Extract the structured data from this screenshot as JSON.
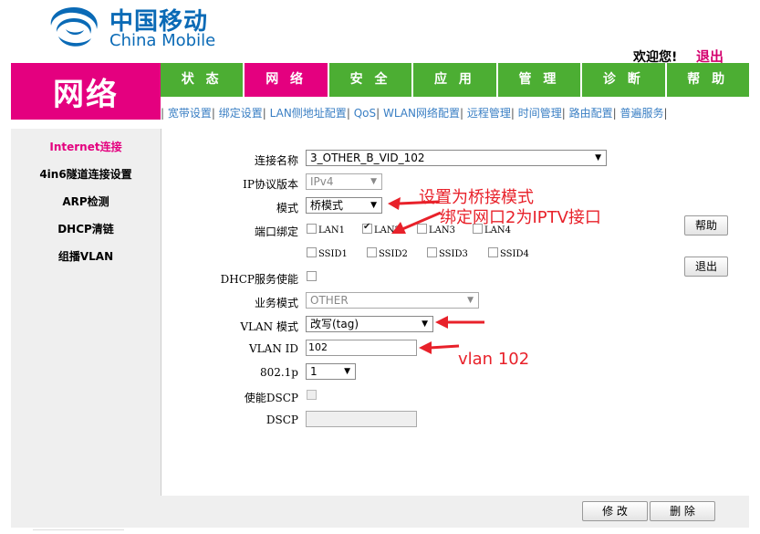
{
  "brand": {
    "cn": "中国移动",
    "en": "China Mobile",
    "color": "#0a6ab6"
  },
  "header": {
    "welcome": "欢迎您!",
    "logout": "退出"
  },
  "section_title": "网络",
  "tabs": [
    {
      "label": "状 态"
    },
    {
      "label": "网 络"
    },
    {
      "label": "安 全"
    },
    {
      "label": "应 用"
    },
    {
      "label": "管 理"
    },
    {
      "label": "诊 断"
    },
    {
      "label": "帮 助"
    }
  ],
  "subnav": [
    "宽带设置",
    "绑定设置",
    "LAN侧地址配置",
    "QoS",
    "WLAN网络配置",
    "远程管理",
    "时间管理",
    "路由配置",
    "普遍服务"
  ],
  "sidebar": [
    "Internet连接",
    "4in6隧道连接设置",
    "ARP检测",
    "DHCP清链",
    "组播VLAN"
  ],
  "form": {
    "conn_name_label": "连接名称",
    "conn_name_value": "3_OTHER_B_VID_102",
    "ip_version_label": "IP协议版本",
    "ip_version_value": "IPv4",
    "mode_label": "模式",
    "mode_value": "桥模式",
    "port_bind_label": "端口绑定",
    "ports": [
      {
        "label": "LAN1",
        "checked": false
      },
      {
        "label": "LAN2",
        "checked": true
      },
      {
        "label": "LAN3",
        "checked": false
      },
      {
        "label": "LAN4",
        "checked": false
      },
      {
        "label": "SSID1",
        "checked": false
      },
      {
        "label": "SSID2",
        "checked": false
      },
      {
        "label": "SSID3",
        "checked": false
      },
      {
        "label": "SSID4",
        "checked": false
      }
    ],
    "dhcp_label": "DHCP服务使能",
    "service_mode_label": "业务模式",
    "service_mode_value": "OTHER",
    "vlan_mode_label": "VLAN 模式",
    "vlan_mode_value": "改写(tag)",
    "vlan_id_label": "VLAN ID",
    "vlan_id_value": "102",
    "p8021_label": "802.1p",
    "p8021_value": "1",
    "dscp_enable_label": "使能DSCP",
    "dscp_label": "DSCP",
    "dscp_value": ""
  },
  "side_buttons": {
    "help": "帮助",
    "logout": "退出"
  },
  "bottom_buttons": {
    "modify": "修 改",
    "delete": "删 除"
  },
  "annotations": {
    "bridge": "设置为桥接模式",
    "bind": "绑定网口2为IPTV接口",
    "vlan": "vlan 102"
  },
  "colors": {
    "accent": "#e4007f",
    "tab_green": "#4cae33",
    "annotation_red": "#e8212a"
  }
}
